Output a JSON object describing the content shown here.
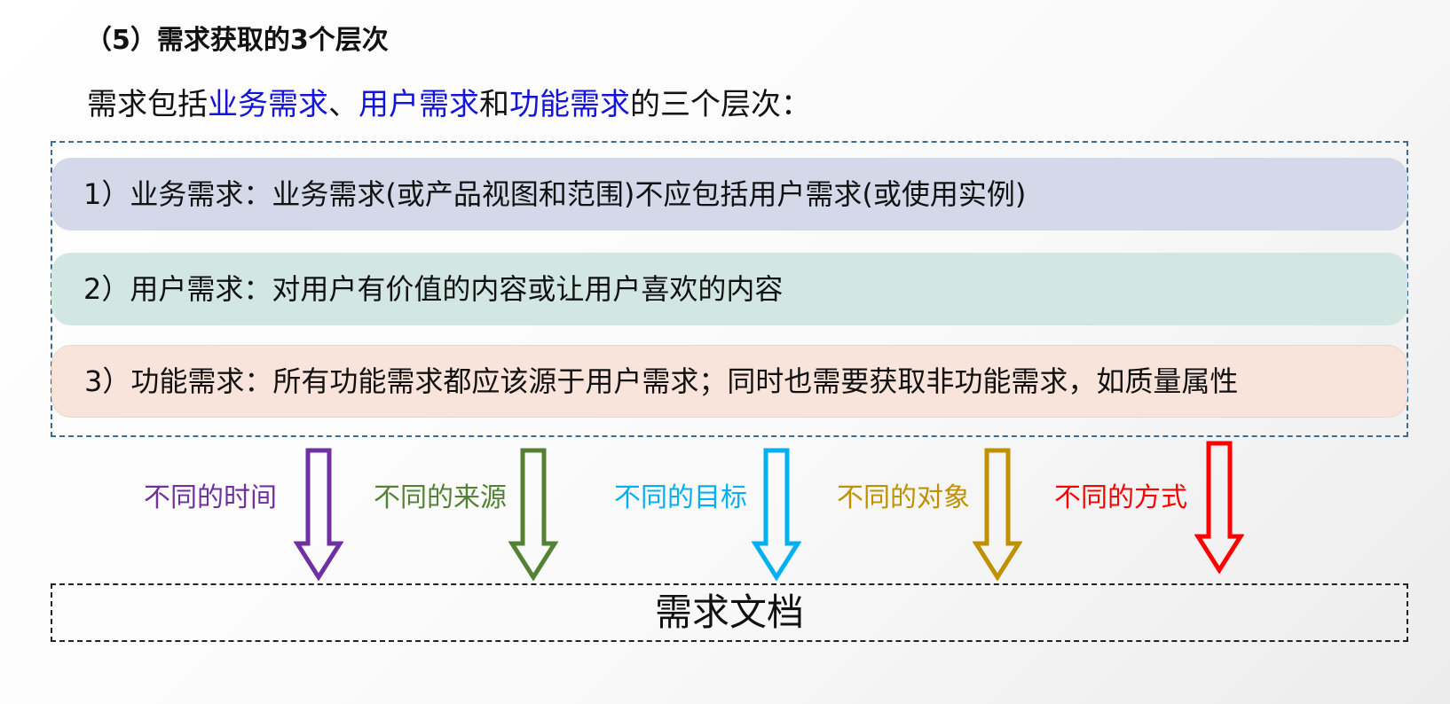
{
  "heading": "（5）需求获取的3个层次",
  "intro": {
    "prefix": "需求包括",
    "item1": "业务需求",
    "sep1": "、",
    "item2": "用户需求",
    "sep2": "和",
    "item3": "功能需求",
    "suffix": "的三个层次："
  },
  "levels": [
    {
      "text": "1）业务需求：业务需求(或产品视图和范围)不应包括用户需求(或使用实例)",
      "color": "#d4d9ea"
    },
    {
      "text": "2）用户需求：对用户有价值的内容或让用户喜欢的内容",
      "color": "#d3e7e2"
    },
    {
      "text": "3）功能需求：所有功能需求都应该源于用户需求；同时也需要获取非功能需求，如质量属性",
      "color": "#f8e4da"
    }
  ],
  "arrows": [
    {
      "label": "不同的时间",
      "color": "#7030a0",
      "icon": "down-arrow-icon"
    },
    {
      "label": "不同的来源",
      "color": "#548235",
      "icon": "down-arrow-icon"
    },
    {
      "label": "不同的目标",
      "color": "#00b0f0",
      "icon": "down-arrow-icon"
    },
    {
      "label": "不同的对象",
      "color": "#bf9000",
      "icon": "down-arrow-icon"
    },
    {
      "label": "不同的方式",
      "color": "#ff0000",
      "icon": "down-arrow-icon"
    }
  ],
  "document_box": "需求文档",
  "accent_color": "#1414d6"
}
